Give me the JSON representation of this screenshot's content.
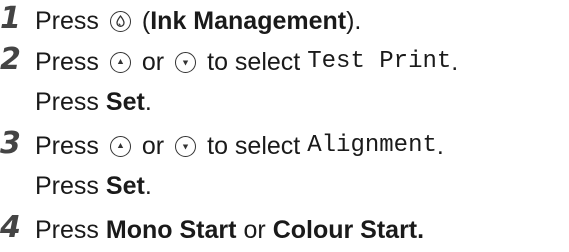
{
  "steps": [
    {
      "number": "1",
      "press": "Press",
      "paren_open": "(",
      "button_name": "Ink Management",
      "paren_close": ")."
    },
    {
      "number": "2",
      "press": "Press",
      "or": "or",
      "to_select": "to select",
      "target": "Test Print",
      "period": ".",
      "press2": "Press",
      "set": "Set",
      "period2": "."
    },
    {
      "number": "3",
      "press": "Press",
      "or": "or",
      "to_select": "to select",
      "target": "Alignment",
      "period": ".",
      "press2": "Press",
      "set": "Set",
      "period2": "."
    },
    {
      "number": "4",
      "press": "Press",
      "btn1": "Mono Start",
      "or": "or",
      "btn2": "Colour Start",
      "period": "."
    }
  ]
}
